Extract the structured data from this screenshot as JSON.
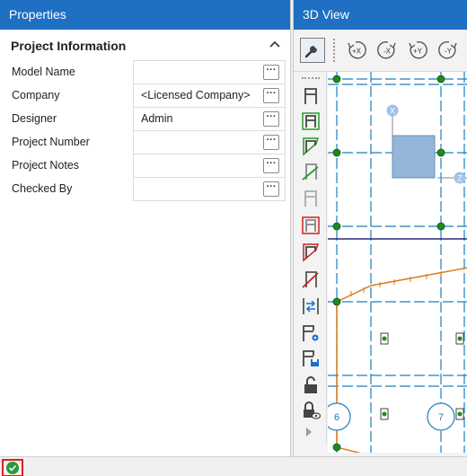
{
  "properties": {
    "title": "Properties",
    "section_title": "Project Information",
    "fields": [
      {
        "label": "Model Name",
        "value": ""
      },
      {
        "label": "Company",
        "value": "<Licensed Company>"
      },
      {
        "label": "Designer",
        "value": "Admin"
      },
      {
        "label": "Project Number",
        "value": ""
      },
      {
        "label": "Project Notes",
        "value": ""
      },
      {
        "label": "Checked By",
        "value": ""
      }
    ],
    "ellipsis": "···"
  },
  "view3d": {
    "title": "3D View",
    "rotate_buttons": [
      "+X",
      "-X",
      "+Y",
      "-Y"
    ],
    "axis_labels": {
      "x": "X",
      "z": "Z"
    },
    "gridline_labels": [
      "6",
      "7"
    ]
  },
  "colors": {
    "header_blue": "#1f6fc2",
    "grid_blue": "#1a7fc0",
    "node_green": "#1e8a1e",
    "beam_orange": "#d97b1a",
    "navy_line": "#2a2a7a",
    "status_red": "#e02020"
  }
}
